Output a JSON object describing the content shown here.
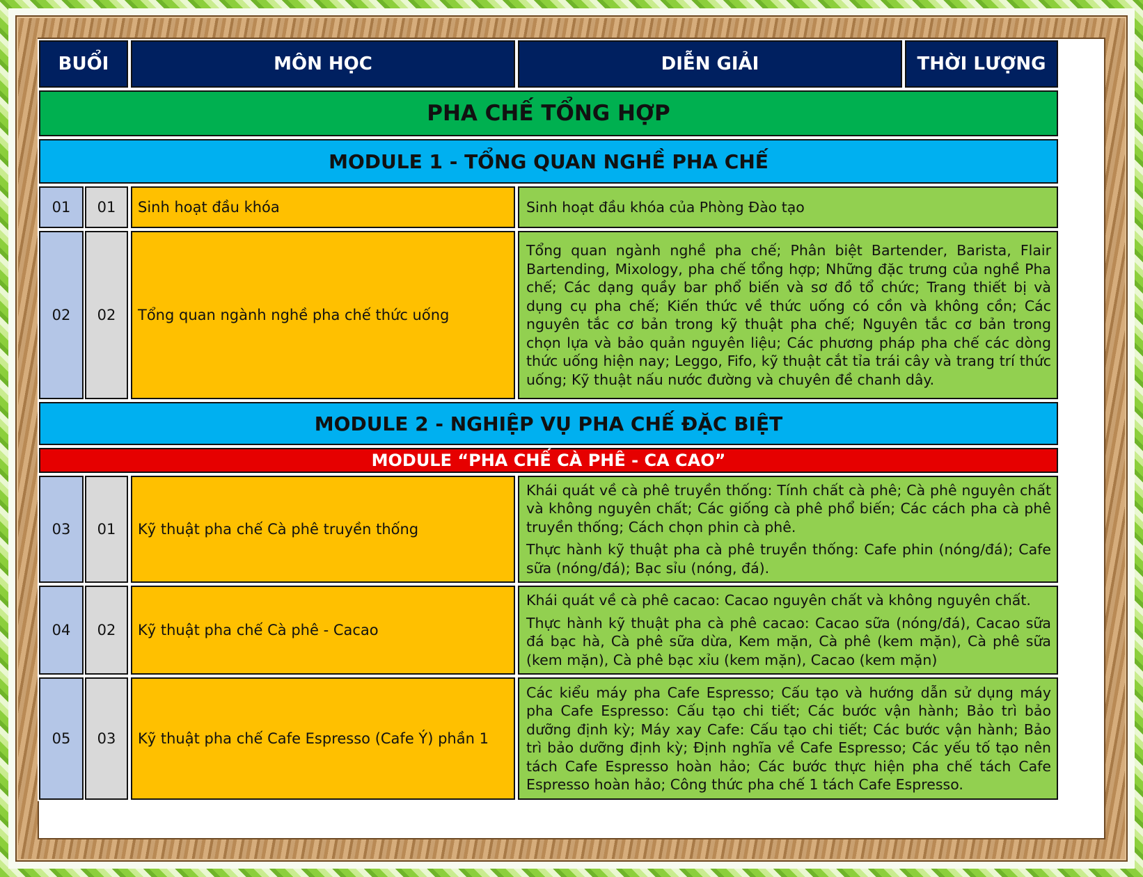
{
  "header": {
    "session": "BUỔI",
    "subject": "MÔN HỌC",
    "description": "DIỄN GIẢI",
    "duration": "THỜI LƯỢNG"
  },
  "course_title": "PHA CHẾ TỔNG HỢP",
  "module1": {
    "title": "MODULE 1 -  TỔNG QUAN NGHỀ PHA CHẾ",
    "rows": [
      {
        "session": "01",
        "lesson": "01",
        "subject": "Sinh hoạt đầu khóa",
        "description": [
          "Sinh hoạt đầu khóa của Phòng Đào tạo"
        ]
      },
      {
        "session": "02",
        "lesson": "02",
        "subject": "Tổng quan ngành nghề pha chế thức uống",
        "description": [
          "Tổng quan ngành nghề pha chế; Phân biệt Bartender, Barista, Flair Bartending, Mixology, pha chế tổng hợp; Những đặc trưng của nghề Pha chế; Các dạng quầy bar phổ biến và sơ đồ tổ chức; Trang thiết bị và dụng cụ pha chế; Kiến thức về thức uống có cồn và không cồn; Các nguyên tắc cơ bản trong kỹ thuật pha chế; Nguyên tắc cơ bản trong chọn lựa và bảo quản nguyên liệu; Các phương pháp pha chế các dòng thức uống hiện nay; Leggo, Fifo, kỹ thuật cắt tỉa trái cây và trang trí thức uống; Kỹ thuật nấu nước đường và chuyên đề chanh dây."
        ]
      }
    ]
  },
  "module2": {
    "title": "MODULE 2 - NGHIỆP VỤ PHA CHẾ ĐẶC BIỆT",
    "submodule": "MODULE “PHA CHẾ CÀ PHÊ - CA CAO”",
    "rows": [
      {
        "session": "03",
        "lesson": "01",
        "subject": "Kỹ thuật pha chế Cà phê truyền thống",
        "description": [
          "Khái quát về cà phê truyền thống: Tính chất cà phê; Cà phê nguyên chất và không nguyên chất; Các giống cà phê phổ biến; Các cách pha cà phê truyền thống; Cách chọn phin cà phê.",
          "Thực hành kỹ thuật pha cà phê truyền thống: Cafe phin (nóng/đá); Cafe sữa (nóng/đá); Bạc sỉu (nóng, đá)."
        ]
      },
      {
        "session": "04",
        "lesson": "02",
        "subject": "Kỹ thuật pha chế Cà phê - Cacao",
        "description": [
          "Khái quát về cà phê cacao: Cacao nguyên chất và không nguyên chất.",
          "Thực hành kỹ thuật pha cà phê cacao: Cacao sữa (nóng/đá), Cacao sữa đá bạc hà, Cà phê sữa dừa, Kem mặn, Cà phê (kem mặn), Cà phê sữa (kem mặn), Cà phê bạc xỉu (kem mặn), Cacao (kem mặn)"
        ]
      },
      {
        "session": "05",
        "lesson": "03",
        "subject": "Kỹ thuật pha chế Cafe Espresso (Cafe Ý) phần 1",
        "description": [
          "Các kiểu máy pha Cafe Espresso; Cấu tạo và hướng dẫn sử dụng máy pha Cafe Espresso: Cấu tạo chi tiết; Các bước vận hành; Bảo trì bảo dưỡng định kỳ; Máy xay Cafe: Cấu tạo chi tiết; Các bước vận hành; Bảo trì bảo dưỡng định kỳ; Định nghĩa về Cafe Espresso; Các yếu tố tạo nên tách Cafe Espresso hoàn hảo; Các bước thực hiện pha chế tách Cafe Espresso hoàn hảo; Công thức pha chế 1 tách Cafe Espresso."
        ]
      }
    ]
  }
}
